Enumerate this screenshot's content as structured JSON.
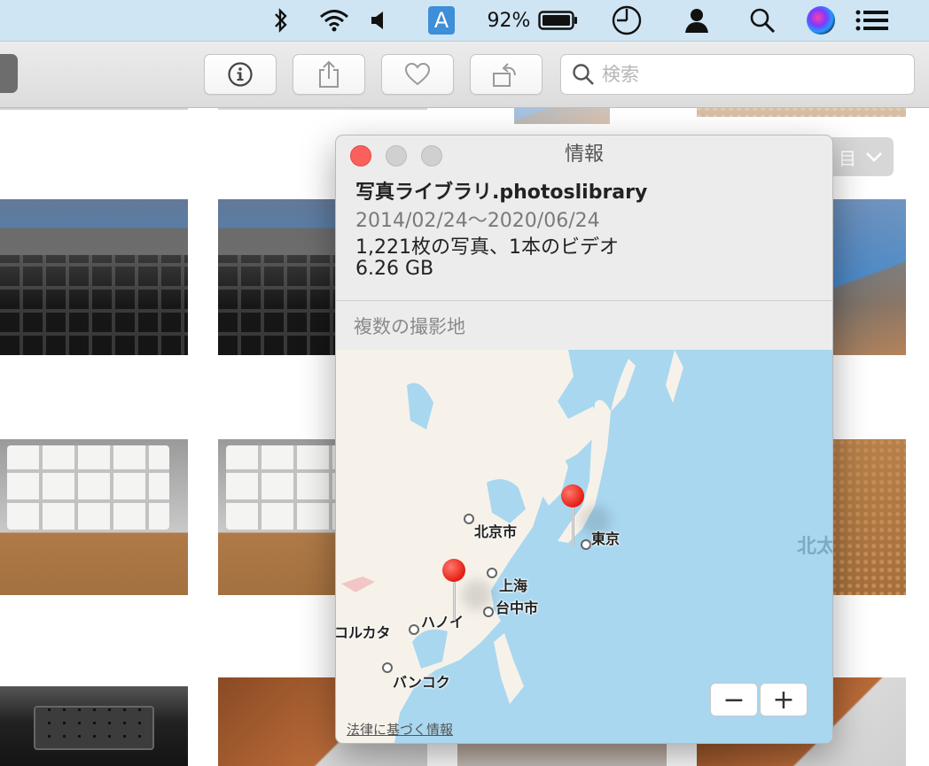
{
  "menubar": {
    "input_indicator": "A",
    "battery_percent": "92%",
    "icons": [
      "bluetooth-icon",
      "wifi-icon",
      "volume-icon",
      "input-source-icon",
      "battery-icon",
      "clock-icon",
      "user-icon",
      "spotlight-icon",
      "siri-icon",
      "notification-center-icon"
    ]
  },
  "toolbar": {
    "buttons": [
      "info-icon",
      "share-icon",
      "heart-icon",
      "rotate-icon"
    ],
    "search_placeholder": "検索"
  },
  "view_dropdown": {
    "label": "目"
  },
  "info_panel": {
    "title": "情報",
    "library_name": "写真ライブラリ.photoslibrary",
    "date_range": "2014/02/24〜2020/06/24",
    "counts": "1,221枚の写真、1本のビデオ",
    "size": "6.26 GB",
    "location_label": "複数の撮影地",
    "map": {
      "cities": [
        {
          "name": "北京市"
        },
        {
          "name": "東京"
        },
        {
          "name": "上海"
        },
        {
          "name": "台中市"
        },
        {
          "name": "ハノイ"
        },
        {
          "name": "コルカタ"
        },
        {
          "name": "バンコク"
        }
      ],
      "edge_label": "北太",
      "legal": "法律に基づく情報",
      "zoom_out": "−",
      "zoom_in": "+"
    },
    "colors": {
      "close": "#fc605c",
      "inactive": "#d0d0d0",
      "pin": "#e51d12",
      "water": "#a9d7f0",
      "land": "#f6f2ea"
    }
  }
}
